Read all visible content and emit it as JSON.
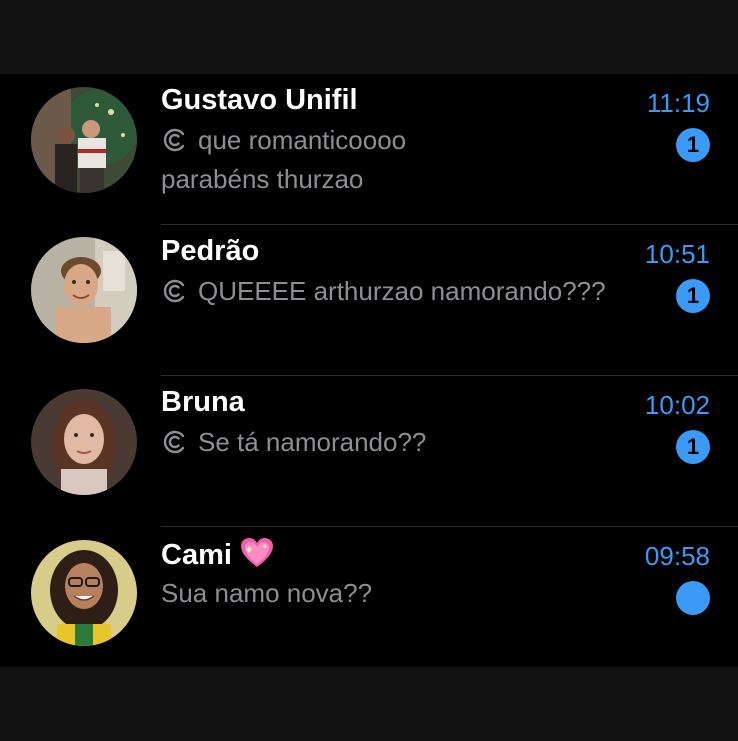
{
  "chats": [
    {
      "name": "Gustavo Unifil",
      "time": "11:19",
      "preview_lines": [
        "que romanticoooo",
        "parabéns thurzao"
      ],
      "status_icon": "sent-check-icon",
      "unread": "1"
    },
    {
      "name": "Pedrão",
      "time": "10:51",
      "preview_lines": [
        "QUEEEE arthurzao namorando???"
      ],
      "status_icon": "sent-check-icon",
      "unread": "1"
    },
    {
      "name": "Bruna",
      "time": "10:02",
      "preview_lines": [
        "Se tá namorando??"
      ],
      "status_icon": "sent-check-icon",
      "unread": "1"
    },
    {
      "name": "Cami",
      "name_emoji": "sparkling-heart-icon",
      "time": "09:58",
      "preview_lines": [
        "Sua namo nova??"
      ],
      "unread": ""
    }
  ],
  "colors": {
    "accent": "#3a9af5",
    "background": "#000000",
    "bar": "#121212",
    "name": "#ffffff",
    "preview": "#8e8e93"
  }
}
